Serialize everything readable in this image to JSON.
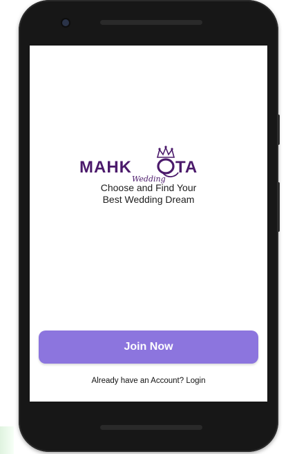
{
  "app": {
    "logo_text_left": "MAHK",
    "logo_text_right": "TA",
    "logo_script": "Wedding",
    "tagline_line1": "Choose and Find Your",
    "tagline_line2": "Best Wedding Dream",
    "join_button_label": "Join Now",
    "login_prompt": "Already have an Account? Login"
  },
  "colors": {
    "brand_purple": "#4b1a6b",
    "button_purple": "#8c75de",
    "phone_body": "#171717"
  },
  "icons": [
    "crown-icon",
    "camera-lens-icon"
  ]
}
